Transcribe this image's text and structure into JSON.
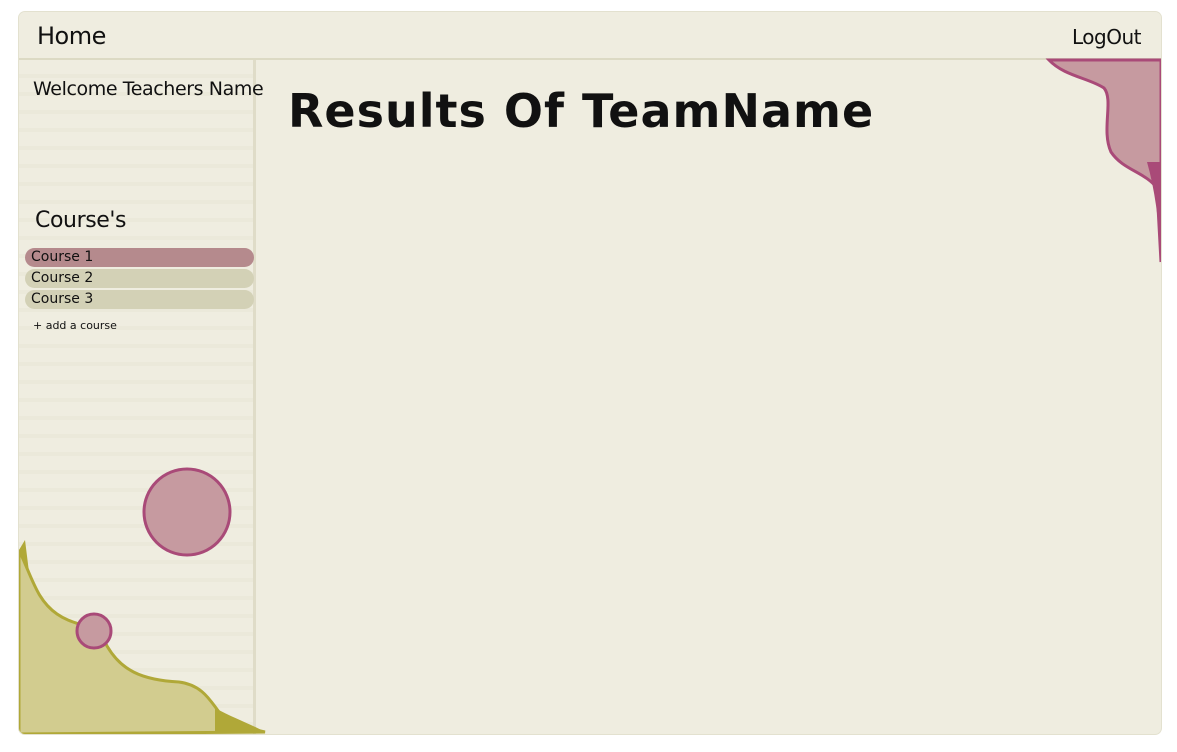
{
  "header": {
    "home_label": "Home",
    "logout_label": "LogOut"
  },
  "sidebar": {
    "welcome_text": "Welcome Teachers Name",
    "courses_heading": "Course's",
    "courses": [
      {
        "label": "Course 1",
        "active": true
      },
      {
        "label": "Course 2",
        "active": false
      },
      {
        "label": "Course 3",
        "active": false
      }
    ],
    "add_course_label": "+ add a course"
  },
  "main": {
    "title": "Results Of TeamName"
  },
  "colors": {
    "background": "#efede0",
    "active_course": "#b58a8d",
    "course_item": "#d3d1b6",
    "blob_pink": "#c69aa0",
    "blob_pink_outline": "#a94a78",
    "blob_olive": "#d2cc8f",
    "blob_olive_outline": "#b0a838"
  }
}
